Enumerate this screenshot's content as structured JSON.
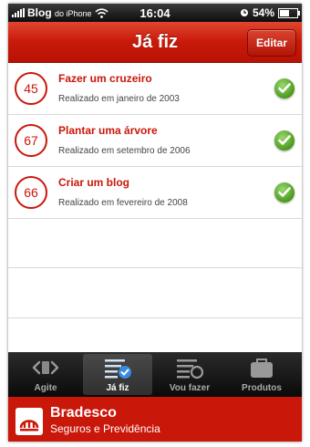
{
  "status_bar": {
    "carrier": "Blog",
    "carrier_suffix": "do iPhone",
    "time": "16:04",
    "battery": "54%",
    "battery_level": 0.54
  },
  "nav": {
    "title": "Já fiz",
    "edit_label": "Editar"
  },
  "items": [
    {
      "badge": "45",
      "title": "Fazer um cruzeiro",
      "subtitle": "Realizado em janeiro de 2003"
    },
    {
      "badge": "67",
      "title": "Plantar uma árvore",
      "subtitle": "Realizado em setembro de 2006"
    },
    {
      "badge": "66",
      "title": "Criar um blog",
      "subtitle": "Realizado em fevereiro de 2008"
    }
  ],
  "tabs": [
    {
      "label": "Agite",
      "icon": "shake-icon",
      "active": false
    },
    {
      "label": "Já fiz",
      "icon": "checklist-icon",
      "active": true
    },
    {
      "label": "Vou fazer",
      "icon": "todo-list-icon",
      "active": false
    },
    {
      "label": "Produtos",
      "icon": "briefcase-icon",
      "active": false
    }
  ],
  "footer": {
    "brand": "Bradesco",
    "tagline": "Seguros e Previdência"
  },
  "colors": {
    "accent": "#c9170a",
    "check": "#4a9a1c"
  }
}
